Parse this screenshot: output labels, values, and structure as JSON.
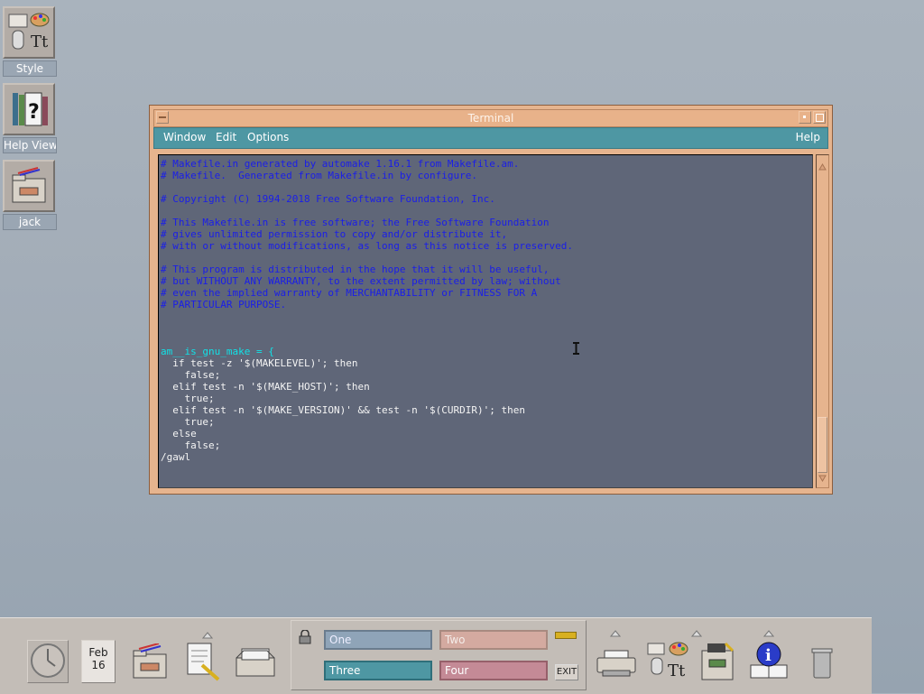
{
  "desktop_icons": [
    {
      "label": "Style",
      "icon": "style-manager-icon"
    },
    {
      "label": "Help View",
      "icon": "help-viewer-icon"
    },
    {
      "label": "jack",
      "icon": "home-folder-icon"
    }
  ],
  "terminal": {
    "title": "Terminal",
    "menus": {
      "window": "Window",
      "edit": "Edit",
      "options": "Options",
      "help": "Help"
    },
    "lines": [
      "# Makefile.in generated by automake 1.16.1 from Makefile.am.",
      "# Makefile.  Generated from Makefile.in by configure.",
      "",
      "# Copyright (C) 1994-2018 Free Software Foundation, Inc.",
      "",
      "# This Makefile.in is free software; the Free Software Foundation",
      "# gives unlimited permission to copy and/or distribute it,",
      "# with or without modifications, as long as this notice is preserved.",
      "",
      "# This program is distributed in the hope that it will be useful,",
      "# but WITHOUT ANY WARRANTY, to the extent permitted by law; without",
      "# even the implied warranty of MERCHANTABILITY or FITNESS FOR A",
      "# PARTICULAR PURPOSE.",
      "",
      "",
      "",
      "am__is_gnu_make = {",
      "  if test -z '$(MAKELEVEL)'; then",
      "    false;",
      "  elif test -n '$(MAKE_HOST)'; then",
      "    true;",
      "  elif test -n '$(MAKE_VERSION)' && test -n '$(CURDIR)'; then",
      "    true;",
      "  else",
      "    false;",
      "/gawl"
    ]
  },
  "panel": {
    "date_month": "Feb",
    "date_day": "16",
    "workspaces": [
      "One",
      "Two",
      "Three",
      "Four"
    ],
    "exit_label": "EXIT",
    "colors": {
      "active_ws": "#4e97a3",
      "ws_one": "#8fa4b8",
      "ws_two": "#d4aaa0",
      "ws_four": "#c48a96"
    }
  }
}
